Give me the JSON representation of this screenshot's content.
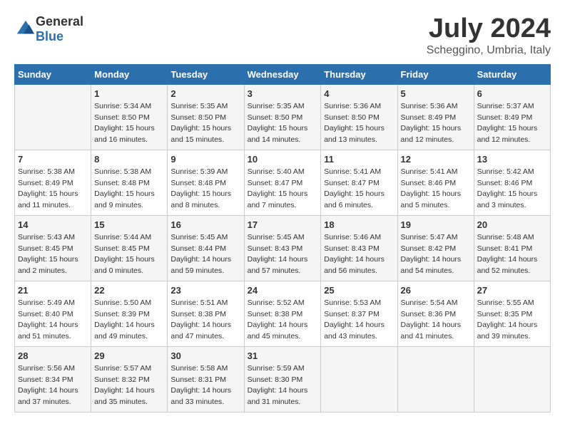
{
  "header": {
    "logo": {
      "general": "General",
      "blue": "Blue"
    },
    "title": "July 2024",
    "location": "Scheggino, Umbria, Italy"
  },
  "weekdays": [
    "Sunday",
    "Monday",
    "Tuesday",
    "Wednesday",
    "Thursday",
    "Friday",
    "Saturday"
  ],
  "weeks": [
    [
      {
        "day": "",
        "info": ""
      },
      {
        "day": "1",
        "info": "Sunrise: 5:34 AM\nSunset: 8:50 PM\nDaylight: 15 hours\nand 16 minutes."
      },
      {
        "day": "2",
        "info": "Sunrise: 5:35 AM\nSunset: 8:50 PM\nDaylight: 15 hours\nand 15 minutes."
      },
      {
        "day": "3",
        "info": "Sunrise: 5:35 AM\nSunset: 8:50 PM\nDaylight: 15 hours\nand 14 minutes."
      },
      {
        "day": "4",
        "info": "Sunrise: 5:36 AM\nSunset: 8:50 PM\nDaylight: 15 hours\nand 13 minutes."
      },
      {
        "day": "5",
        "info": "Sunrise: 5:36 AM\nSunset: 8:49 PM\nDaylight: 15 hours\nand 12 minutes."
      },
      {
        "day": "6",
        "info": "Sunrise: 5:37 AM\nSunset: 8:49 PM\nDaylight: 15 hours\nand 12 minutes."
      }
    ],
    [
      {
        "day": "7",
        "info": "Sunrise: 5:38 AM\nSunset: 8:49 PM\nDaylight: 15 hours\nand 11 minutes."
      },
      {
        "day": "8",
        "info": "Sunrise: 5:38 AM\nSunset: 8:48 PM\nDaylight: 15 hours\nand 9 minutes."
      },
      {
        "day": "9",
        "info": "Sunrise: 5:39 AM\nSunset: 8:48 PM\nDaylight: 15 hours\nand 8 minutes."
      },
      {
        "day": "10",
        "info": "Sunrise: 5:40 AM\nSunset: 8:47 PM\nDaylight: 15 hours\nand 7 minutes."
      },
      {
        "day": "11",
        "info": "Sunrise: 5:41 AM\nSunset: 8:47 PM\nDaylight: 15 hours\nand 6 minutes."
      },
      {
        "day": "12",
        "info": "Sunrise: 5:41 AM\nSunset: 8:46 PM\nDaylight: 15 hours\nand 5 minutes."
      },
      {
        "day": "13",
        "info": "Sunrise: 5:42 AM\nSunset: 8:46 PM\nDaylight: 15 hours\nand 3 minutes."
      }
    ],
    [
      {
        "day": "14",
        "info": "Sunrise: 5:43 AM\nSunset: 8:45 PM\nDaylight: 15 hours\nand 2 minutes."
      },
      {
        "day": "15",
        "info": "Sunrise: 5:44 AM\nSunset: 8:45 PM\nDaylight: 15 hours\nand 0 minutes."
      },
      {
        "day": "16",
        "info": "Sunrise: 5:45 AM\nSunset: 8:44 PM\nDaylight: 14 hours\nand 59 minutes."
      },
      {
        "day": "17",
        "info": "Sunrise: 5:45 AM\nSunset: 8:43 PM\nDaylight: 14 hours\nand 57 minutes."
      },
      {
        "day": "18",
        "info": "Sunrise: 5:46 AM\nSunset: 8:43 PM\nDaylight: 14 hours\nand 56 minutes."
      },
      {
        "day": "19",
        "info": "Sunrise: 5:47 AM\nSunset: 8:42 PM\nDaylight: 14 hours\nand 54 minutes."
      },
      {
        "day": "20",
        "info": "Sunrise: 5:48 AM\nSunset: 8:41 PM\nDaylight: 14 hours\nand 52 minutes."
      }
    ],
    [
      {
        "day": "21",
        "info": "Sunrise: 5:49 AM\nSunset: 8:40 PM\nDaylight: 14 hours\nand 51 minutes."
      },
      {
        "day": "22",
        "info": "Sunrise: 5:50 AM\nSunset: 8:39 PM\nDaylight: 14 hours\nand 49 minutes."
      },
      {
        "day": "23",
        "info": "Sunrise: 5:51 AM\nSunset: 8:38 PM\nDaylight: 14 hours\nand 47 minutes."
      },
      {
        "day": "24",
        "info": "Sunrise: 5:52 AM\nSunset: 8:38 PM\nDaylight: 14 hours\nand 45 minutes."
      },
      {
        "day": "25",
        "info": "Sunrise: 5:53 AM\nSunset: 8:37 PM\nDaylight: 14 hours\nand 43 minutes."
      },
      {
        "day": "26",
        "info": "Sunrise: 5:54 AM\nSunset: 8:36 PM\nDaylight: 14 hours\nand 41 minutes."
      },
      {
        "day": "27",
        "info": "Sunrise: 5:55 AM\nSunset: 8:35 PM\nDaylight: 14 hours\nand 39 minutes."
      }
    ],
    [
      {
        "day": "28",
        "info": "Sunrise: 5:56 AM\nSunset: 8:34 PM\nDaylight: 14 hours\nand 37 minutes."
      },
      {
        "day": "29",
        "info": "Sunrise: 5:57 AM\nSunset: 8:32 PM\nDaylight: 14 hours\nand 35 minutes."
      },
      {
        "day": "30",
        "info": "Sunrise: 5:58 AM\nSunset: 8:31 PM\nDaylight: 14 hours\nand 33 minutes."
      },
      {
        "day": "31",
        "info": "Sunrise: 5:59 AM\nSunset: 8:30 PM\nDaylight: 14 hours\nand 31 minutes."
      },
      {
        "day": "",
        "info": ""
      },
      {
        "day": "",
        "info": ""
      },
      {
        "day": "",
        "info": ""
      }
    ]
  ]
}
